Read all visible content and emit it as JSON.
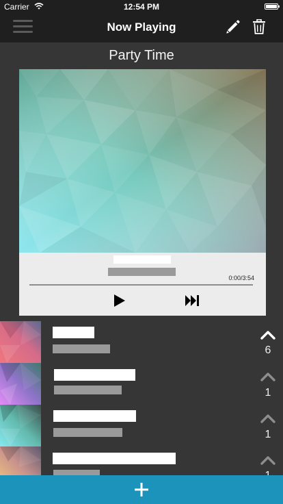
{
  "status_bar": {
    "carrier": "Carrier",
    "time": "12:54 PM",
    "icons": [
      "wifi-icon",
      "battery-icon"
    ]
  },
  "nav": {
    "title": "Now Playing",
    "left_icon": "hamburger-menu-icon",
    "right_icons": [
      "pencil-icon",
      "trash-icon"
    ]
  },
  "playlist": {
    "name": "Party Time"
  },
  "now_playing": {
    "time": "0:00/3:54",
    "progress": 0.0,
    "controls": [
      "play-icon",
      "skip-forward-icon"
    ]
  },
  "queue": {
    "items": [
      {
        "votes": "6",
        "upvoted": true
      },
      {
        "votes": "1",
        "upvoted": false
      },
      {
        "votes": "1",
        "upvoted": false
      },
      {
        "votes": "1",
        "upvoted": false
      }
    ]
  },
  "add_button": {
    "icon": "plus-icon"
  },
  "colors": {
    "background": "#363636",
    "nav_background": "#1f1f1f",
    "accent": "#1b93ba",
    "upvoted": "#ffffff",
    "not_upvoted": "#8d8d8d"
  }
}
